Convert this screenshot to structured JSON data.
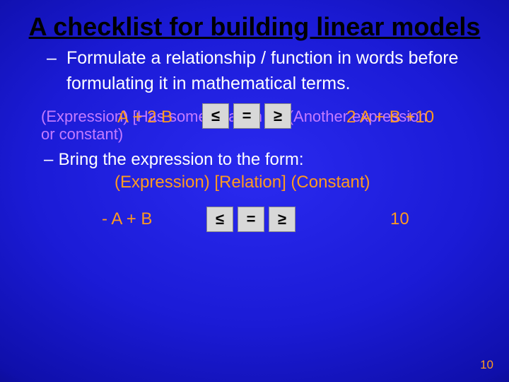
{
  "title": "A checklist for building linear models",
  "bullet_main": "Formulate a relationship / function in words before            formulating it in mathematical terms.",
  "purple_line": "(Expression) [Has some relation to] (Another expression\nor constant)",
  "orange_overlay_left": "A + 2 B",
  "orange_overlay_right": "2 A  + B  +10",
  "rel_ops": {
    "le": "≤",
    "eq": "=",
    "ge": "≥"
  },
  "bring_line": "Bring the expression to the form:",
  "form_line": "(Expression) [Relation] (Constant)",
  "final_left": "- A  + B",
  "final_right": "10",
  "page_number": "10"
}
